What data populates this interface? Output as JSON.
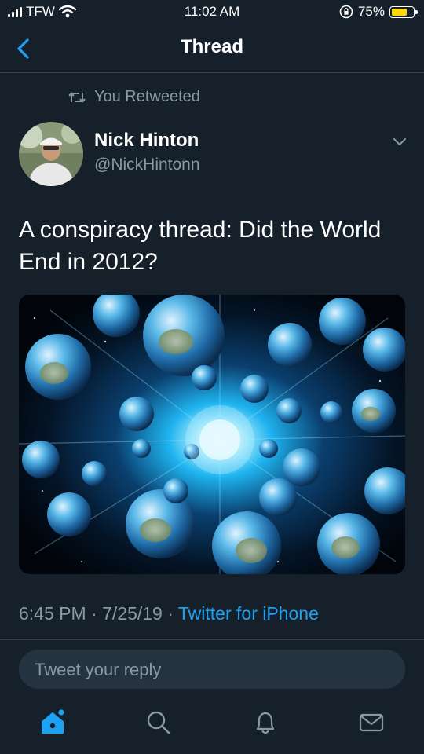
{
  "status_bar": {
    "carrier": "TFW",
    "time": "11:02 AM",
    "battery": "75%",
    "battery_level": 0.75,
    "battery_color": "#ffd60a"
  },
  "nav": {
    "title": "Thread",
    "back_icon": "chevron-left-icon"
  },
  "retweet": {
    "label": "You Retweeted"
  },
  "tweet": {
    "author_name": "Nick Hinton",
    "author_handle": "@NickHintonn",
    "text": "A conspiracy thread: Did the World End in 2012?",
    "time": "6:45 PM",
    "date": "7/25/19",
    "separator": "·",
    "source": "Twitter for iPhone"
  },
  "reply": {
    "placeholder": "Tweet your reply"
  },
  "tab_bar": {
    "items": [
      "home-icon",
      "search-icon",
      "notifications-icon",
      "messages-icon"
    ]
  },
  "colors": {
    "background": "#15202b",
    "accent": "#1da1f2",
    "secondary_text": "#8899a6",
    "divider": "#38444d"
  }
}
